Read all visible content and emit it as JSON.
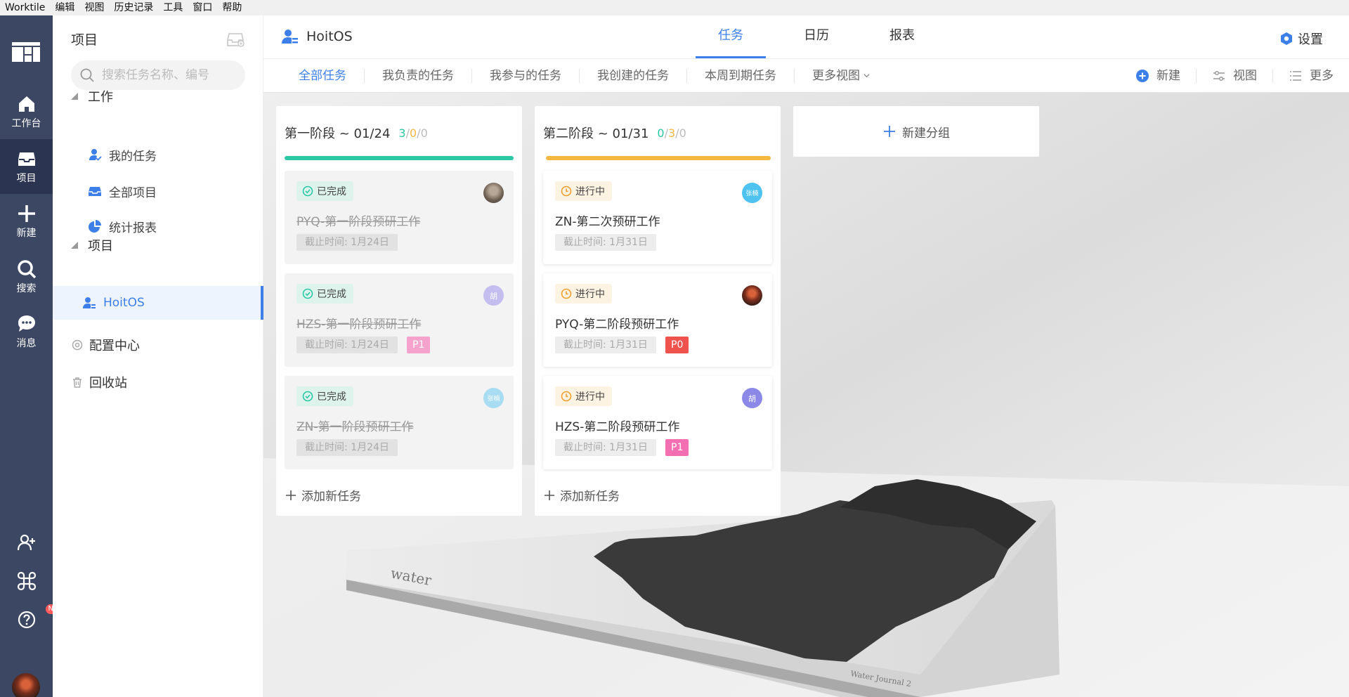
{
  "menubar": [
    "Worktile",
    "编辑",
    "视图",
    "历史记录",
    "工具",
    "窗口",
    "帮助"
  ],
  "rail": {
    "items": [
      {
        "label": "工作台",
        "icon": "home-icon"
      },
      {
        "label": "项目",
        "icon": "inbox-icon"
      },
      {
        "label": "新建",
        "icon": "plus-icon"
      },
      {
        "label": "搜索",
        "icon": "search-icon"
      },
      {
        "label": "消息",
        "icon": "chat-icon"
      }
    ],
    "new_badge": "New"
  },
  "sidebar": {
    "title": "项目",
    "search_placeholder": "搜索任务名称、编号",
    "work_section": "工作",
    "work_items": [
      {
        "label": "我的任务",
        "icon": "user-task-icon"
      },
      {
        "label": "全部项目",
        "icon": "inbox-icon"
      },
      {
        "label": "统计报表",
        "icon": "pie-chart-icon"
      }
    ],
    "project_section": "项目",
    "project_items": [
      {
        "label": "HoitOS",
        "icon": "project-user-icon"
      }
    ],
    "config": "配置中心",
    "trash": "回收站"
  },
  "header": {
    "project_name": "HoitOS",
    "tabs": [
      "任务",
      "日历",
      "报表"
    ],
    "settings": "设置"
  },
  "subnav": {
    "views": [
      "全部任务",
      "我负责的任务",
      "我参与的任务",
      "我创建的任务",
      "本周到期任务",
      "更多视图"
    ],
    "actions": [
      "新建",
      "视图",
      "更多"
    ]
  },
  "colors": {
    "accent": "#3d7fe8",
    "done_green": "#2cc8a5",
    "progress_yellow": "#f5b942",
    "p0": "#f0524d",
    "p1": "#f46fb1",
    "rail": "#3c4764"
  },
  "columns": [
    {
      "title": "第一阶段 ~ 01/24",
      "counts": {
        "done": "3",
        "progress": "0",
        "todo": "0"
      },
      "bar_color": "#2cc8a5",
      "add_task": "添加新任务",
      "cards": [
        {
          "status": "已完成",
          "title": "PYQ-第一阶段预研工作",
          "due": "截止时间: 1月24日",
          "priority": "",
          "avatar": ""
        },
        {
          "status": "已完成",
          "title": "HZS-第一阶段预研工作",
          "due": "截止时间: 1月24日",
          "priority": "P1",
          "avatar": "胡"
        },
        {
          "status": "已完成",
          "title": "ZN-第一阶段预研工作",
          "due": "截止时间: 1月24日",
          "priority": "",
          "avatar": "张楠"
        }
      ]
    },
    {
      "title": "第二阶段 ~ 01/31",
      "counts": {
        "done": "0",
        "progress": "3",
        "todo": "0"
      },
      "bar_color": "#f5b942",
      "add_task": "添加新任务",
      "cards": [
        {
          "status": "进行中",
          "title": "ZN-第二次预研工作",
          "due": "截止时间: 1月31日",
          "priority": "",
          "avatar": "张楠"
        },
        {
          "status": "进行中",
          "title": "PYQ-第二阶段预研工作",
          "due": "截止时间: 1月31日",
          "priority": "P0",
          "avatar": ""
        },
        {
          "status": "进行中",
          "title": "HZS-第二阶段预研工作",
          "due": "截止时间: 1月31日",
          "priority": "P1",
          "avatar": "胡"
        }
      ]
    }
  ],
  "new_group": "新建分组",
  "photo": {
    "book_title": "water",
    "book_spine": "Water Journal 2"
  }
}
